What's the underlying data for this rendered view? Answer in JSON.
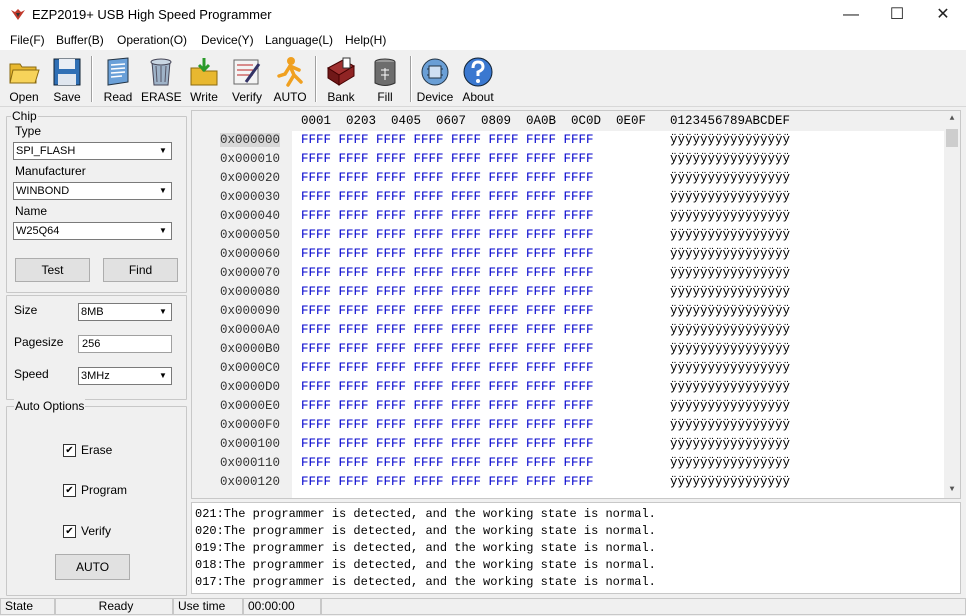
{
  "window": {
    "title": "EZP2019+ USB High Speed Programmer",
    "min_glyph": "—",
    "max_glyph": "☐",
    "close_glyph": "✕"
  },
  "menu": [
    "File(F)",
    "Buffer(B)",
    "Operation(O)",
    "Device(Y)",
    "Language(L)",
    "Help(H)"
  ],
  "toolbar": [
    {
      "label": "Open",
      "icon": "folder-icon"
    },
    {
      "label": "Save",
      "icon": "floppy-icon"
    },
    {
      "label": "Read",
      "icon": "read-icon"
    },
    {
      "label": "ERASE",
      "icon": "erase-icon"
    },
    {
      "label": "Write",
      "icon": "write-icon"
    },
    {
      "label": "Verify",
      "icon": "verify-icon"
    },
    {
      "label": "AUTO",
      "icon": "auto-icon"
    },
    {
      "label": "Bank",
      "icon": "bank-icon"
    },
    {
      "label": "Fill",
      "icon": "fill-icon"
    },
    {
      "label": "Device",
      "icon": "device-icon"
    },
    {
      "label": "About",
      "icon": "about-icon"
    }
  ],
  "chip": {
    "group_label": "Chip",
    "type_label": "Type",
    "type_value": "SPI_FLASH",
    "manufacturer_label": "Manufacturer",
    "manufacturer_value": "WINBOND",
    "name_label": "Name",
    "name_value": "W25Q64",
    "test_button": "Test",
    "find_button": "Find"
  },
  "params": {
    "size_label": "Size",
    "size_value": "8MB",
    "pagesize_label": "Pagesize",
    "pagesize_value": "256",
    "speed_label": "Speed",
    "speed_value": "3MHz"
  },
  "auto_options": {
    "group_label": "Auto Options",
    "erase_label": "Erase",
    "erase_checked": true,
    "program_label": "Program",
    "program_checked": true,
    "verify_label": "Verify",
    "verify_checked": true,
    "auto_button": "AUTO"
  },
  "hex": {
    "header": [
      "0001",
      "0203",
      "0405",
      "0607",
      "0809",
      "0A0B",
      "0C0D",
      "0E0F",
      "0123456789ABCDEF"
    ],
    "addresses": [
      "0x000000",
      "0x000010",
      "0x000020",
      "0x000030",
      "0x000040",
      "0x000050",
      "0x000060",
      "0x000070",
      "0x000080",
      "0x000090",
      "0x0000A0",
      "0x0000B0",
      "0x0000C0",
      "0x0000D0",
      "0x0000E0",
      "0x0000F0",
      "0x000100",
      "0x000110",
      "0x000120"
    ],
    "row_data": "FFFF FFFF FFFF FFFF FFFF FFFF FFFF FFFF",
    "row_ascii": "ÿÿÿÿÿÿÿÿÿÿÿÿÿÿÿÿ"
  },
  "log": [
    "021:The programmer is detected, and the working state is normal.",
    "020:The programmer is detected, and the working state is normal.",
    "019:The programmer is detected, and the working state is normal.",
    "018:The programmer is detected, and the working state is normal.",
    "017:The programmer is detected, and the working state is normal."
  ],
  "status": {
    "state_label": "State",
    "state_value": "Ready",
    "time_label": "Use time",
    "time_value": "00:00:00"
  }
}
